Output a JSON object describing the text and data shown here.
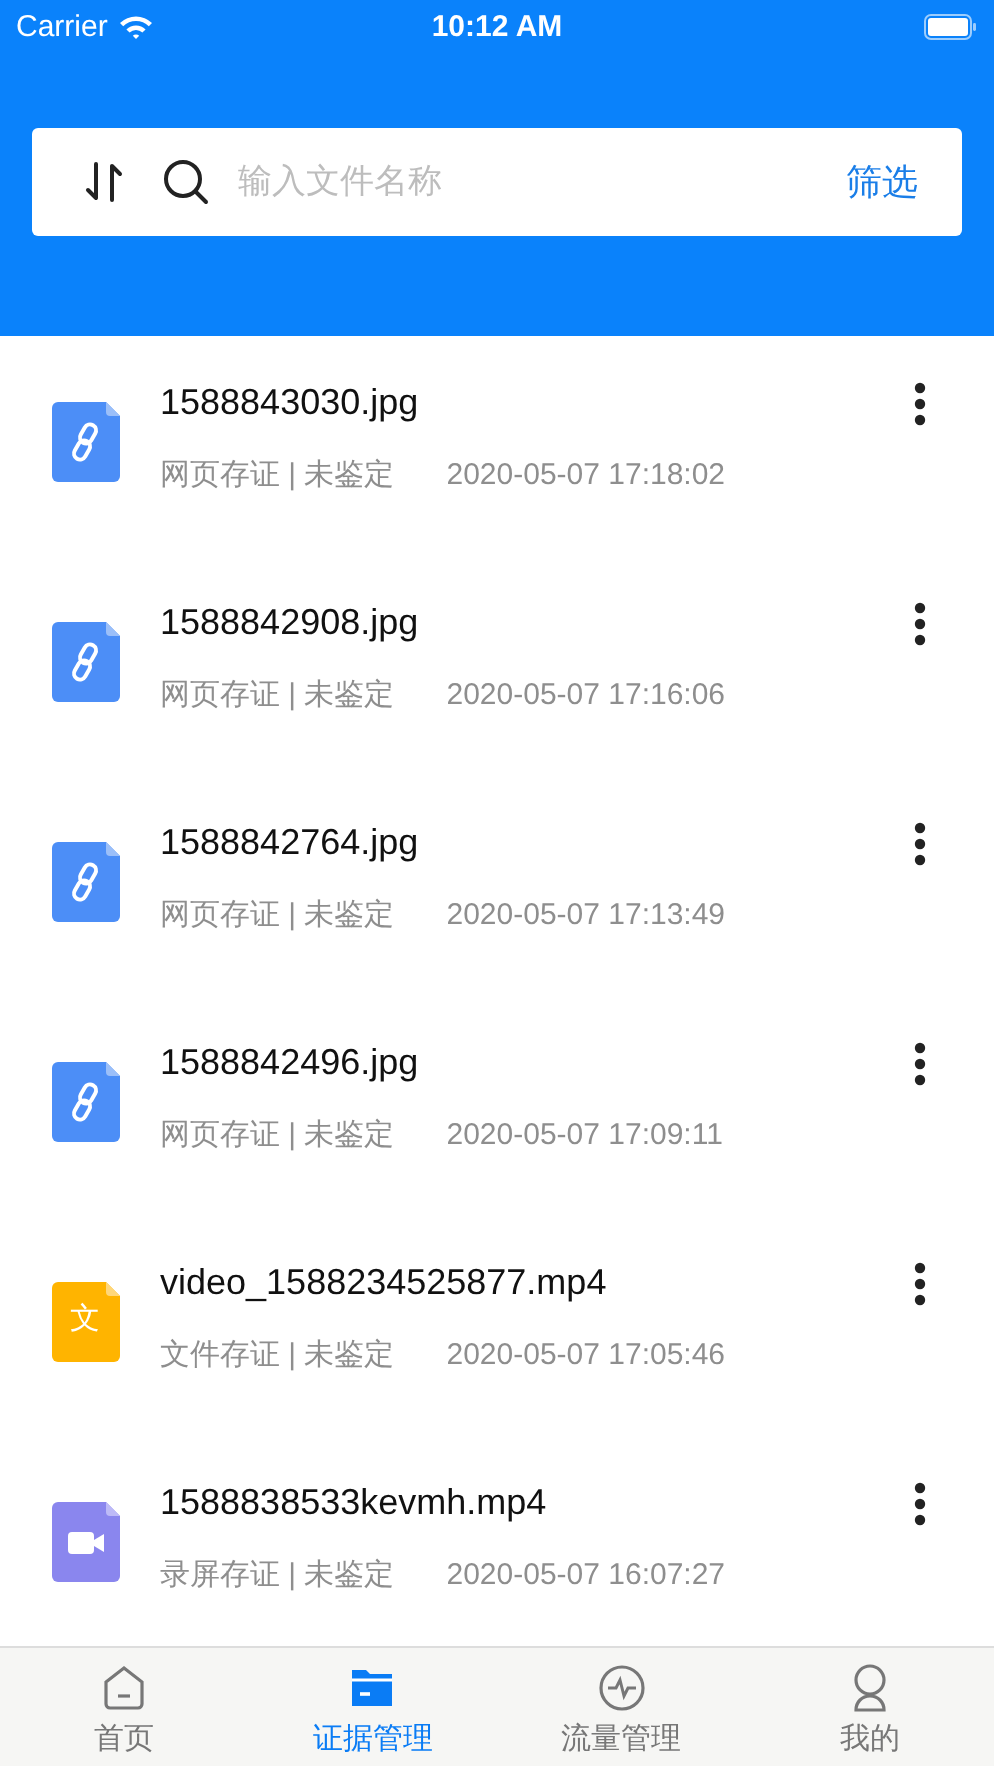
{
  "status_bar": {
    "carrier": "Carrier",
    "time": "10:12 AM"
  },
  "search": {
    "placeholder": "输入文件名称",
    "filter": "筛选"
  },
  "files": [
    {
      "name": "1588843030.jpg",
      "kind": "link",
      "meta": "网页存证 | 未鉴定",
      "time": "2020-05-07 17:18:02"
    },
    {
      "name": "1588842908.jpg",
      "kind": "link",
      "meta": "网页存证 | 未鉴定",
      "time": "2020-05-07 17:16:06"
    },
    {
      "name": "1588842764.jpg",
      "kind": "link",
      "meta": "网页存证 | 未鉴定",
      "time": "2020-05-07 17:13:49"
    },
    {
      "name": "1588842496.jpg",
      "kind": "link",
      "meta": "网页存证 | 未鉴定",
      "time": "2020-05-07 17:09:11"
    },
    {
      "name": "video_1588234525877.mp4",
      "kind": "text",
      "icon_text": "文",
      "meta": "文件存证 | 未鉴定",
      "time": "2020-05-07 17:05:46"
    },
    {
      "name": "1588838533kevmh.mp4",
      "kind": "video",
      "meta": "录屏存证 | 未鉴定",
      "time": "2020-05-07 16:07:27"
    }
  ],
  "tabs": [
    {
      "label": "首页",
      "kind": "home",
      "selected": false
    },
    {
      "label": "证据管理",
      "kind": "folder",
      "selected": true
    },
    {
      "label": "流量管理",
      "kind": "pulse",
      "selected": false
    },
    {
      "label": "我的",
      "kind": "person",
      "selected": false
    }
  ]
}
